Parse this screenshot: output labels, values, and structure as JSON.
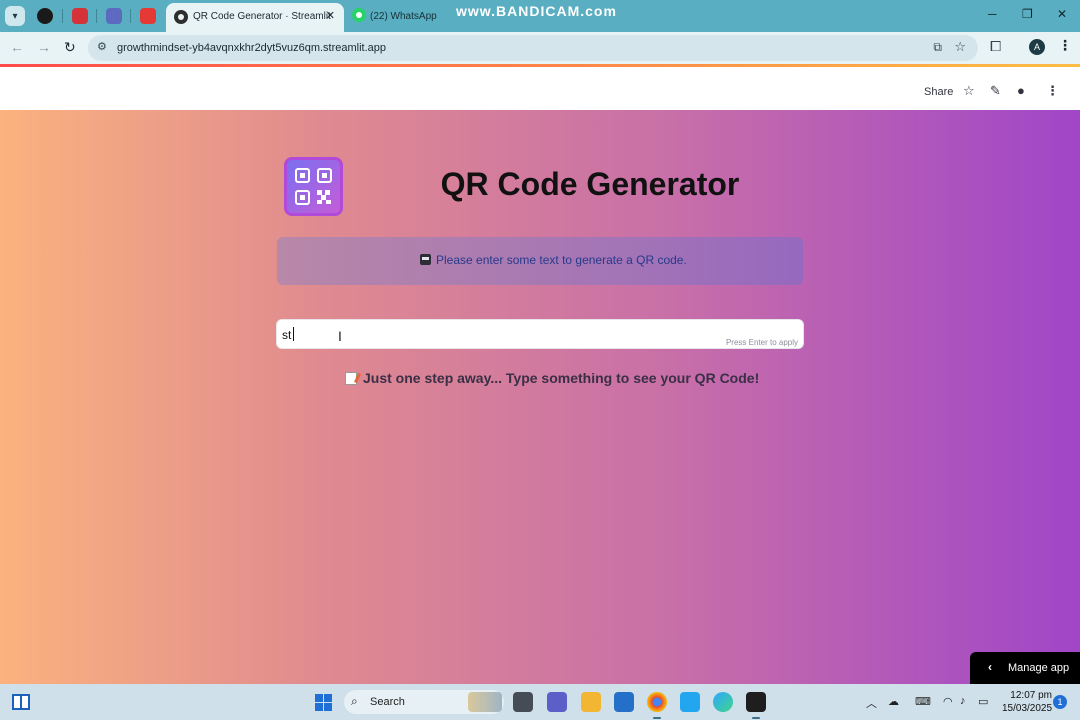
{
  "browser": {
    "tabs": [
      {
        "title": "QR Code Generator · Streamlit",
        "active": true
      },
      {
        "title": "(22) WhatsApp",
        "active": false
      }
    ],
    "watermark": "www.BANDICAM.com",
    "address_bar": {
      "url": "growthmindset-yb4avqnxkhr2dyt5vuz6qm.streamlit.app"
    },
    "profile_initial": "A",
    "icons": {
      "back": "arrow-left-icon",
      "forward": "arrow-right-icon",
      "reload": "reload-icon",
      "site_info": "tune-icon",
      "install": "install-app-icon",
      "bookmark": "star-icon",
      "extensions": "puzzle-icon",
      "menu": "kebab-icon",
      "minimize": "minimize-icon",
      "maximize": "maximize-icon",
      "close": "close-icon"
    }
  },
  "streamlit_header": {
    "share_label": "Share",
    "icons": [
      "star-icon",
      "pencil-icon",
      "github-icon",
      "kebab-icon"
    ]
  },
  "app": {
    "title": "QR Code Generator",
    "info_message": "Please enter some text to generate a QR code.",
    "input": {
      "value": "st",
      "hint": "Press Enter to apply"
    },
    "step_message": "Just one step away... Type something to see your QR Code!",
    "manage_app_label": "Manage app",
    "colors": {
      "gradient_start": "#fbb27e",
      "gradient_end": "#a046c8",
      "info_text": "#273a8a"
    }
  },
  "taskbar": {
    "search_label": "Search",
    "time": "12:07 pm",
    "date": "15/03/2025",
    "notification_count": "1"
  }
}
